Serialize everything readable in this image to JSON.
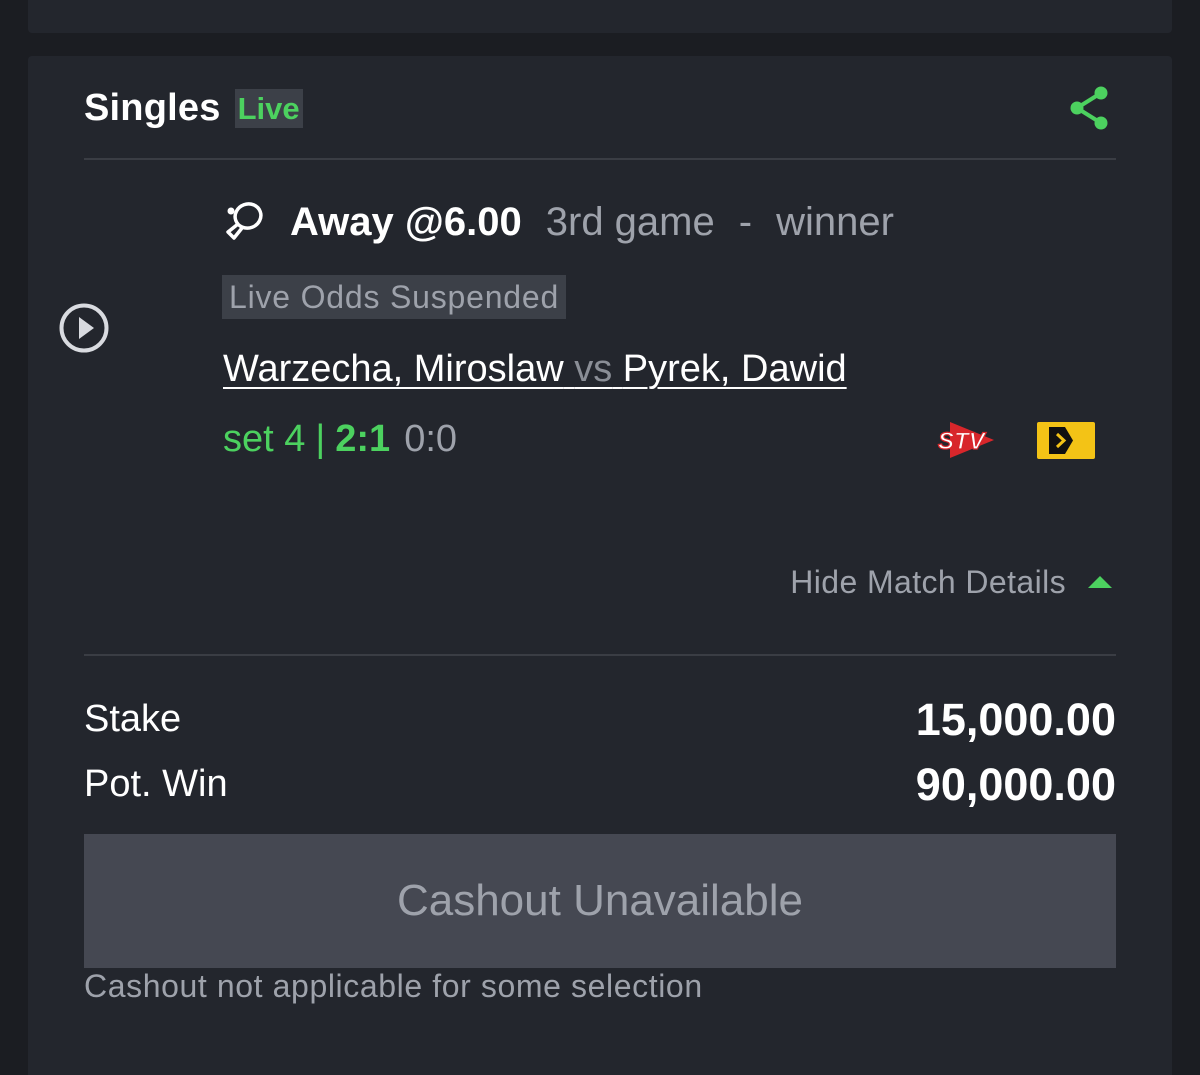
{
  "colors": {
    "background": "#1b1d22",
    "card": "#23262d",
    "accent_green": "#4cd15f",
    "muted_text": "#9ea2ab",
    "badge_bg": "#3c4048",
    "button_disabled_bg": "#454852"
  },
  "header": {
    "bet_type": "Singles",
    "live_label": "Live",
    "share_icon": "share-icon"
  },
  "selection": {
    "sport_icon": "table-tennis-icon",
    "pick": "Away @6.00",
    "market": "3rd game",
    "separator": "-",
    "market_type": "winner",
    "status": "Live Odds Suspended",
    "home": "Warzecha, Miroslaw",
    "vs": "vs",
    "away": "Pyrek, Dawid",
    "set_label": "set 4",
    "score_separator": "|",
    "set_score": "2:1",
    "game_score": "0:0",
    "play_icon": "play-circle-icon",
    "stream_icons": [
      "stv-icon",
      "video-stream-icon"
    ]
  },
  "details_toggle": {
    "label": "Hide Match Details",
    "icon": "caret-up-icon"
  },
  "summary": {
    "stake_label": "Stake",
    "stake_value": "15,000.00",
    "pot_win_label": "Pot. Win",
    "pot_win_value": "90,000.00"
  },
  "cashout": {
    "button_label": "Cashout Unavailable",
    "note": "Cashout not applicable for some selection"
  }
}
